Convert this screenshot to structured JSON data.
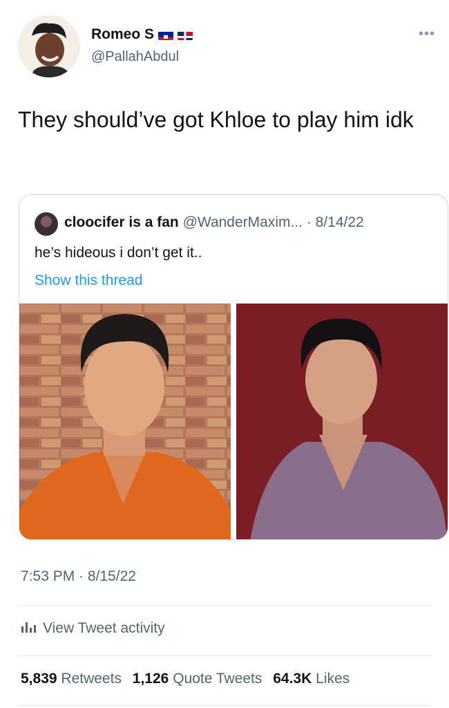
{
  "author": {
    "display_name": "Romeo S",
    "handle": "@PallahAbdul",
    "flags": [
      "haiti-flag-icon",
      "dominican-republic-flag-icon"
    ]
  },
  "tweet": {
    "text": "They should’ve got Khloe to play him idk",
    "timestamp": "7:53 PM · 8/15/22"
  },
  "quoted_tweet": {
    "author_name": "cloocifer is a fan",
    "author_handle": "@WanderMaxim...",
    "date": "· 8/14/22",
    "text": "he’s hideous i don’t get it..",
    "thread_link": "Show this thread"
  },
  "activity": {
    "label": "View Tweet activity"
  },
  "stats": {
    "retweets_count": "5,839",
    "retweets_label": "Retweets",
    "quotes_count": "1,126",
    "quotes_label": "Quote Tweets",
    "likes_count": "64.3K",
    "likes_label": "Likes"
  },
  "colors": {
    "link": "#1d9bf0",
    "secondary_text": "#536471",
    "border": "#cfd9de"
  }
}
